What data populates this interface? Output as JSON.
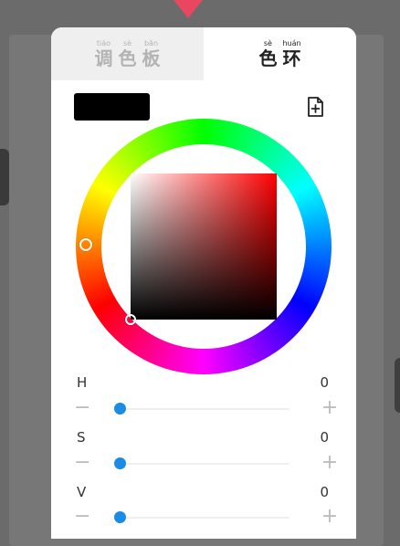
{
  "tabs": [
    {
      "pinyin": [
        "tiáo",
        "sè",
        "bǎn"
      ],
      "hanzi": [
        "调",
        "色",
        "板"
      ],
      "active": false
    },
    {
      "pinyin": [
        "sè",
        "huán"
      ],
      "hanzi": [
        "色",
        "环"
      ],
      "active": true
    }
  ],
  "current_color": "#000000",
  "icons": {
    "save": "add-file-icon"
  },
  "sliders": [
    {
      "label": "H",
      "value": "0",
      "fraction": 0
    },
    {
      "label": "S",
      "value": "0",
      "fraction": 0
    },
    {
      "label": "V",
      "value": "0",
      "fraction": 0
    }
  ],
  "colors": {
    "accent": "#1a8ce6",
    "pointer": "#e8475f",
    "hue": "#ff0000"
  }
}
